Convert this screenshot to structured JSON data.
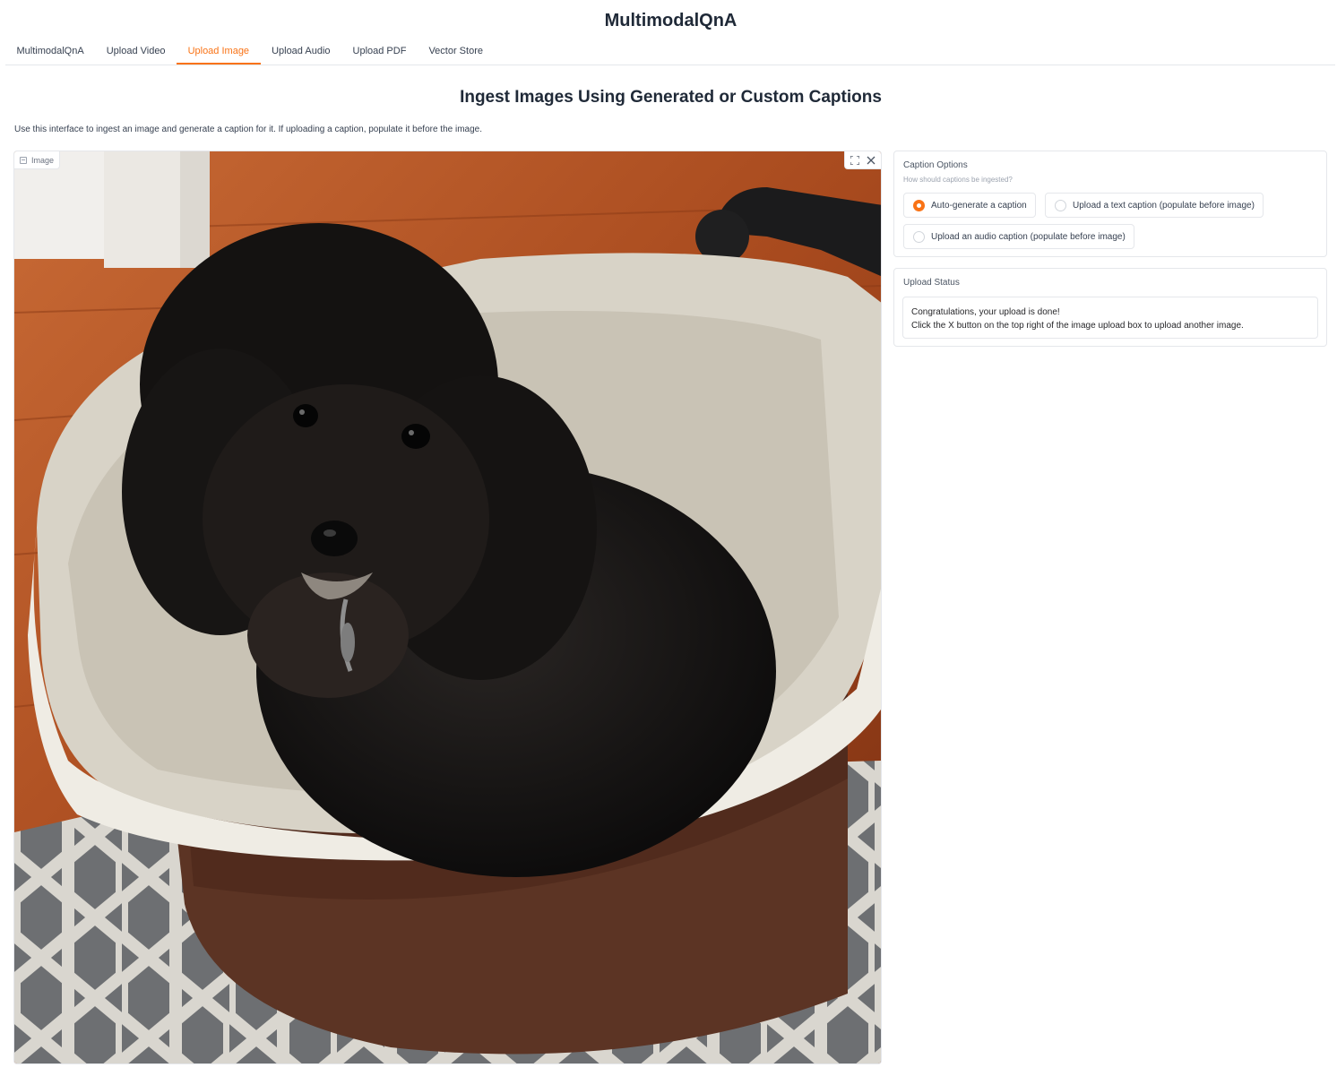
{
  "app": {
    "title": "MultimodalQnA"
  },
  "tabs": [
    {
      "label": "MultimodalQnA",
      "active": false
    },
    {
      "label": "Upload Video",
      "active": false
    },
    {
      "label": "Upload Image",
      "active": true
    },
    {
      "label": "Upload Audio",
      "active": false
    },
    {
      "label": "Upload PDF",
      "active": false
    },
    {
      "label": "Vector Store",
      "active": false
    }
  ],
  "main": {
    "heading": "Ingest Images Using Generated or Custom Captions",
    "intro": "Use this interface to ingest an image and generate a caption for it. If uploading a caption, populate it before the image."
  },
  "image_upload": {
    "label": "Image",
    "fullscreen_icon": "fullscreen-icon",
    "close_icon": "close-icon"
  },
  "caption_options": {
    "title": "Caption Options",
    "info": "How should captions be ingested?",
    "options": [
      {
        "label": "Auto-generate a caption",
        "selected": true
      },
      {
        "label": "Upload a text caption (populate before image)",
        "selected": false
      },
      {
        "label": "Upload an audio caption (populate before image)",
        "selected": false
      }
    ]
  },
  "upload_status": {
    "title": "Upload Status",
    "line1": "Congratulations, your upload is done!",
    "line2": "Click the X button on the top right of the image upload box to upload another image."
  },
  "colors": {
    "accent": "#f97316",
    "border": "#e5e7eb"
  }
}
